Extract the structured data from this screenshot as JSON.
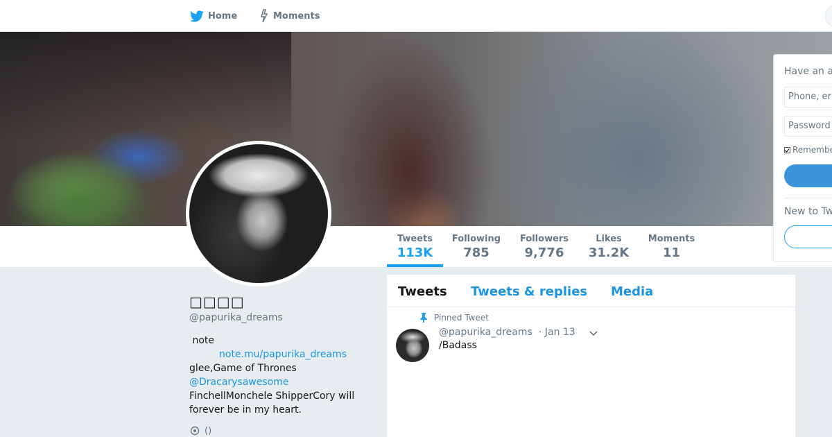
{
  "nav": {
    "home_label": "Home",
    "moments_label": "Moments"
  },
  "profile": {
    "fullname": "□□□□",
    "handle": "@papurika_dreams",
    "bio": {
      "line1": " note",
      "note_link": "note.mu/papurika_dreams",
      "line3": "glee,Game of Thrones",
      "mention": "@Dracarysawesome",
      "line5": "FinchellMonchele ShipperCory will forever be in my heart."
    },
    "location": "()"
  },
  "stats": [
    {
      "label": "Tweets",
      "value": "113K"
    },
    {
      "label": "Following",
      "value": "785"
    },
    {
      "label": "Followers",
      "value": "9,776"
    },
    {
      "label": "Likes",
      "value": "31.2K"
    },
    {
      "label": "Moments",
      "value": "11"
    }
  ],
  "login": {
    "title": "Have an a",
    "phone_placeholder": "Phone, er",
    "password_placeholder": "Password",
    "remember_label": "Remembe",
    "new_to": "New to Tw"
  },
  "timeline": {
    "tabs": [
      "Tweets",
      "Tweets & replies",
      "Media"
    ],
    "pinned_label": "Pinned Tweet",
    "tweet": {
      "handle": "@papurika_dreams",
      "date": "· Jan 13",
      "text": "/Badass"
    }
  },
  "colors": {
    "accent": "#1da1f2",
    "link": "#1b95e0",
    "muted": "#657786",
    "page_bg": "#e6ecf0"
  },
  "icons": [
    "twitter-bird-icon",
    "moments-bolt-icon",
    "pin-icon",
    "chevron-down-icon",
    "location-pin-icon"
  ]
}
